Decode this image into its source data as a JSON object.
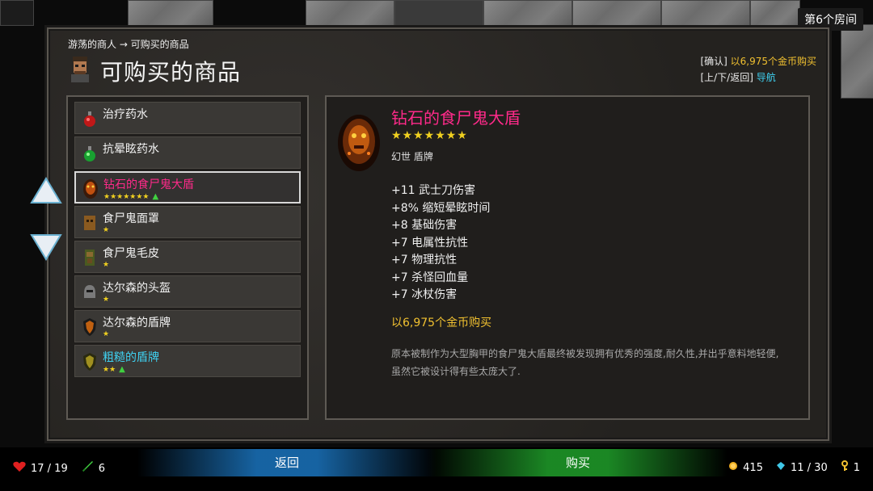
{
  "room": "第6个房间",
  "breadcrumb": "游荡的商人 → 可购买的商品",
  "title": "可购买的商品",
  "hints": {
    "confirm_key": "[确认]",
    "confirm_action": "以6,975个金币购买",
    "nav_key": "[上/下/返回]",
    "nav_action": "导航"
  },
  "items": [
    {
      "name": "治疗药水",
      "stars": "",
      "rarity": "common",
      "upgrade": false,
      "icon": "red-potion-icon"
    },
    {
      "name": "抗晕眩药水",
      "stars": "",
      "rarity": "common",
      "upgrade": false,
      "icon": "green-potion-icon"
    },
    {
      "name": "钻石的食尸鬼大盾",
      "stars": "★★★★★★★",
      "rarity": "epic",
      "upgrade": true,
      "icon": "ghoul-shield-icon"
    },
    {
      "name": "食尸鬼面罩",
      "stars": "★",
      "rarity": "common",
      "upgrade": false,
      "icon": "ghoul-mask-icon"
    },
    {
      "name": "食尸鬼毛皮",
      "stars": "★",
      "rarity": "common",
      "upgrade": false,
      "icon": "ghoul-hide-icon"
    },
    {
      "name": "达尔森的头盔",
      "stars": "★",
      "rarity": "common",
      "upgrade": false,
      "icon": "helmet-icon"
    },
    {
      "name": "达尔森的盾牌",
      "stars": "★",
      "rarity": "common",
      "upgrade": false,
      "icon": "shield-icon"
    },
    {
      "name": "粗糙的盾牌",
      "stars": "★★",
      "rarity": "rare",
      "upgrade": true,
      "icon": "rough-shield-icon"
    }
  ],
  "selected_index": 2,
  "upgrade_symbol": "▲",
  "detail": {
    "name": "钻石的食尸鬼大盾",
    "stars": "★★★★★★★",
    "type": "幻世 盾牌",
    "stats": [
      "+11 武士刀伤害",
      "+8% 缩短晕眩时间",
      "+8 基础伤害",
      "+7 电属性抗性",
      "+7 物理抗性",
      "+7 杀怪回血量",
      "+7 冰杖伤害"
    ],
    "price": "以6,975个金币购买",
    "description": "原本被制作为大型胸甲的食尸鬼大盾最终被发现拥有优秀的强度,耐久性,并出乎意料地轻便,虽然它被设计得有些太庞大了."
  },
  "buttons": {
    "back": "返回",
    "buy": "购买"
  },
  "status": {
    "health": "17 / 19",
    "attack": "6",
    "gold": "415",
    "gems": "11 / 30",
    "keys": "1"
  },
  "colors": {
    "epic": "#ff2a8a",
    "rare": "#3fd0f0",
    "gold": "#f0c030",
    "stars": "#f0d020"
  }
}
